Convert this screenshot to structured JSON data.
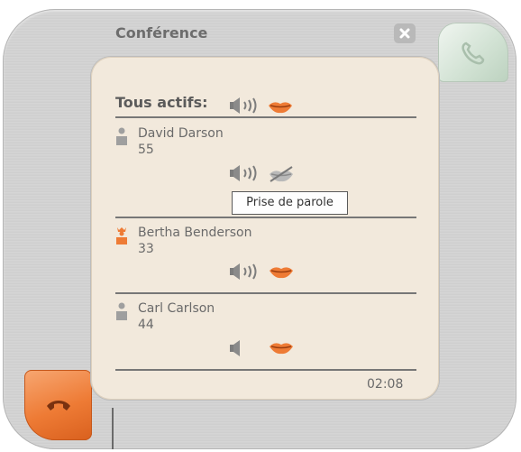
{
  "window": {
    "title": "Conférence"
  },
  "all_active": {
    "label": "Tous actifs:"
  },
  "participants": [
    {
      "name": "David Darson",
      "number": "55",
      "tooltip": "Prise de parole"
    },
    {
      "name": "Bertha Benderson",
      "number": "33"
    },
    {
      "name": "Carl Carlson",
      "number": "44"
    }
  ],
  "footer": {
    "time": "02:08"
  },
  "colors": {
    "accent_orange": "#ee7b35",
    "panel_cream": "#f2e9dc",
    "hangup_green": "#d3e3d5"
  },
  "icons": {
    "speaker": "speaker-icon",
    "lips": "lips-icon",
    "person": "person-icon",
    "close": "close-icon",
    "phone": "phone-icon"
  }
}
